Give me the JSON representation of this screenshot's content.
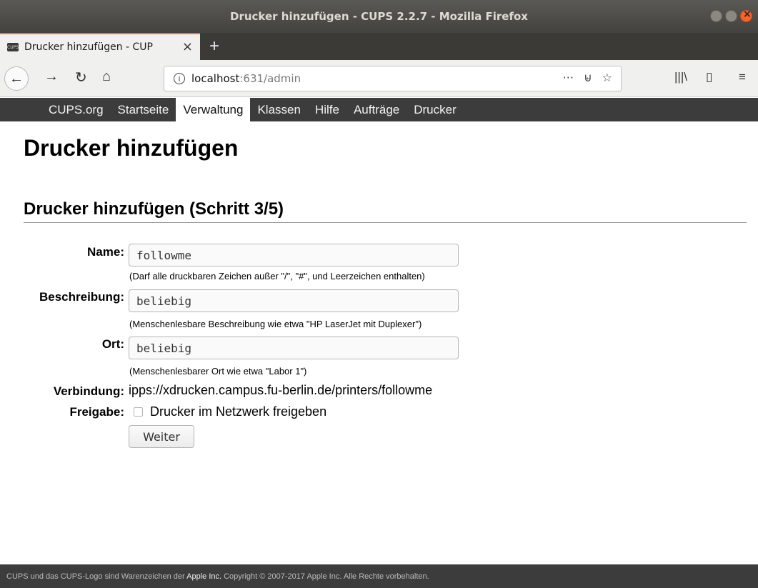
{
  "window": {
    "title": "Drucker hinzufügen - CUPS 2.2.7 - Mozilla Firefox"
  },
  "tab": {
    "favicon_label": "CUPS",
    "label": "Drucker hinzufügen - CUP",
    "close": "×",
    "new_tab": "+"
  },
  "toolbar": {
    "url_host": "localhost",
    "url_path": ":631/admin",
    "more": "···",
    "pocket": "⊌",
    "bookmark": "☆"
  },
  "cups_nav": {
    "items": [
      "CUPS.org",
      "Startseite",
      "Verwaltung",
      "Klassen",
      "Hilfe",
      "Aufträge",
      "Drucker"
    ],
    "active": "Verwaltung"
  },
  "page": {
    "title": "Drucker hinzufügen",
    "subtitle": "Drucker hinzufügen (Schritt 3/5)"
  },
  "form": {
    "name_label": "Name:",
    "name_value": "followme",
    "name_hint": "(Darf alle druckbaren Zeichen außer \"/\", \"#\", und Leerzeichen enthalten)",
    "desc_label": "Beschreibung:",
    "desc_value": "beliebig",
    "desc_hint": "(Menschenlesbare Beschreibung wie etwa \"HP LaserJet mit Duplexer\")",
    "loc_label": "Ort:",
    "loc_value": "beliebig",
    "loc_hint": "(Menschenlesbarer Ort wie etwa \"Labor 1\")",
    "conn_label": "Verbindung:",
    "conn_value": "ipps://xdrucken.campus.fu-berlin.de/printers/followme",
    "share_label": "Freigabe:",
    "share_checkbox_label": "Drucker im Netzwerk freigeben",
    "share_checked": false,
    "submit_label": "Weiter"
  },
  "footer": {
    "pre": "CUPS und das CUPS-Logo sind Warenzeichen der ",
    "apple": "Apple Inc.",
    "post": " Copyright © 2007-2017 Apple Inc. Alle Rechte vorbehalten."
  }
}
